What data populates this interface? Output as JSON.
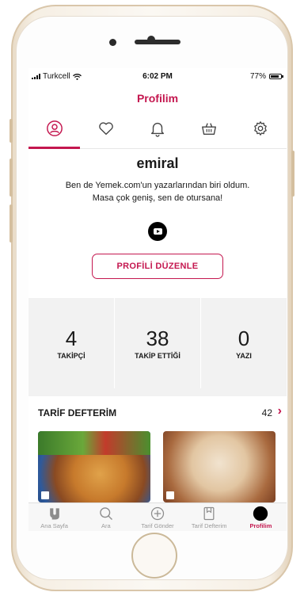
{
  "status_bar": {
    "carrier": "Turkcell",
    "time": "6:02 PM",
    "battery": "77%"
  },
  "header": {
    "title": "Profilim"
  },
  "profile_tabs": [
    {
      "name": "user-icon",
      "active": true
    },
    {
      "name": "heart-icon",
      "active": false
    },
    {
      "name": "bell-icon",
      "active": false
    },
    {
      "name": "basket-icon",
      "active": false
    },
    {
      "name": "gear-icon",
      "active": false
    }
  ],
  "profile": {
    "username": "emiral",
    "bio_line1": "Ben de Yemek.com'un yazarlarından biri oldum.",
    "bio_line2": "Masa çok geniş, sen de otursana!",
    "social_icon": "youtube-icon",
    "edit_button": "PROFİLİ DÜZENLE"
  },
  "stats": [
    {
      "value": "4",
      "label": "TAKİPÇİ"
    },
    {
      "value": "38",
      "label": "TAKİP ETTİĞİ"
    },
    {
      "value": "0",
      "label": "YAZI"
    }
  ],
  "cookbook": {
    "title": "TARİF DEFTERİM",
    "count": "42",
    "chevron": "›"
  },
  "bottom_tabs": [
    {
      "label": "Ana Sayfa",
      "icon": "yemek-logo-icon",
      "active": false
    },
    {
      "label": "Ara",
      "icon": "search-icon",
      "active": false
    },
    {
      "label": "Tarif Gönder",
      "icon": "plus-circle-icon",
      "active": false
    },
    {
      "label": "Tarif Defterim",
      "icon": "bookmark-icon",
      "active": false
    },
    {
      "label": "Profilim",
      "icon": "avatar-icon",
      "active": true
    }
  ],
  "colors": {
    "accent": "#c4174f",
    "background": "#f2f2f2"
  }
}
